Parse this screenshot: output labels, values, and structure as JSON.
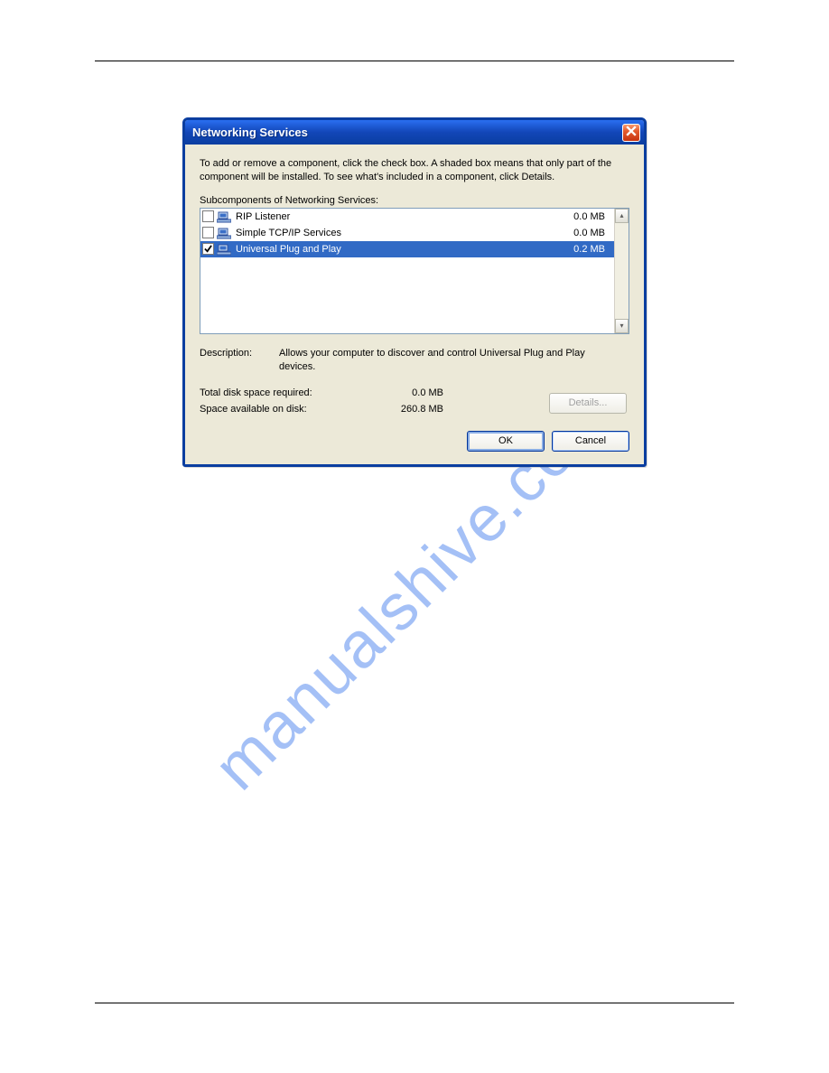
{
  "watermark": "manualshive.com",
  "dialog": {
    "title": "Networking Services",
    "intro": "To add or remove a component, click the check box. A shaded box means that only part of the component will be installed. To see what's included in a component, click Details.",
    "sublabel": "Subcomponents of Networking Services:",
    "items": [
      {
        "checked": false,
        "label": "RIP Listener",
        "size": "0.0 MB",
        "selected": false
      },
      {
        "checked": false,
        "label": "Simple TCP/IP Services",
        "size": "0.0 MB",
        "selected": false
      },
      {
        "checked": true,
        "label": "Universal Plug and Play",
        "size": "0.2 MB",
        "selected": true
      }
    ],
    "description_label": "Description:",
    "description_text": "Allows your computer to discover and control Universal Plug and Play devices.",
    "total_label": "Total disk space required:",
    "total_value": "0.0 MB",
    "avail_label": "Space available on disk:",
    "avail_value": "260.8 MB",
    "details_button": "Details...",
    "ok_button": "OK",
    "cancel_button": "Cancel"
  }
}
